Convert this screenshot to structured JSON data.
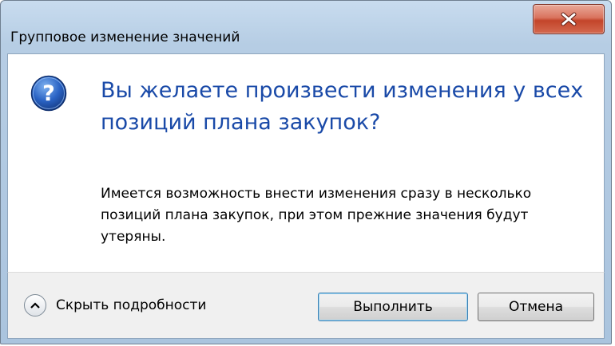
{
  "window": {
    "title": "Групповое изменение значений",
    "close_icon": "close-icon"
  },
  "content": {
    "icon": "question-icon",
    "main_instruction": "Вы желаете произвести изменения у всех позиций плана закупок?",
    "details_text": "Имеется возможность внести изменения сразу в несколько позиций плана закупок, при этом прежние значения будут утеряны."
  },
  "footer": {
    "details_toggle_label": "Скрыть подробности",
    "ok_label": "Выполнить",
    "cancel_label": "Отмена"
  },
  "colors": {
    "instruction_text": "#1a4aa8",
    "close_button": "#c3452a",
    "frame": "#b6cde4"
  }
}
